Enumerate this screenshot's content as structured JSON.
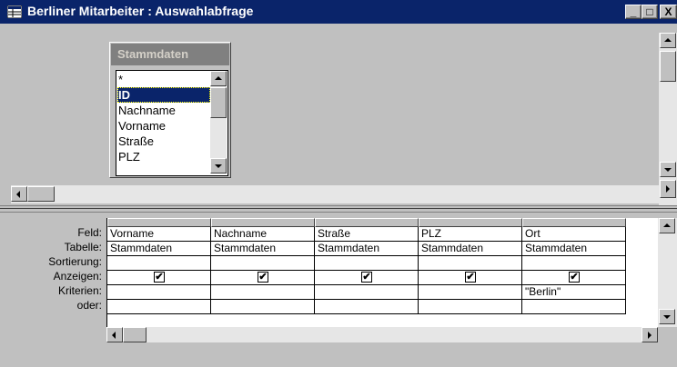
{
  "window": {
    "title": "Berliner Mitarbeiter : Auswahlabfrage",
    "buttons": {
      "minimize": "_",
      "maximize": "□",
      "close": "X"
    }
  },
  "field_list": {
    "title": "Stammdaten",
    "items": [
      "*",
      "ID",
      "Nachname",
      "Vorname",
      "Straße",
      "PLZ"
    ],
    "selected_index": 1
  },
  "grid": {
    "row_labels": [
      "Feld:",
      "Tabelle:",
      "Sortierung:",
      "Anzeigen:",
      "Kriterien:",
      "oder:"
    ],
    "columns": [
      {
        "feld": "Vorname",
        "tabelle": "Stammdaten",
        "sortierung": "",
        "anzeigen": true,
        "kriterien": "",
        "oder": ""
      },
      {
        "feld": "Nachname",
        "tabelle": "Stammdaten",
        "sortierung": "",
        "anzeigen": true,
        "kriterien": "",
        "oder": ""
      },
      {
        "feld": "Straße",
        "tabelle": "Stammdaten",
        "sortierung": "",
        "anzeigen": true,
        "kriterien": "",
        "oder": ""
      },
      {
        "feld": "PLZ",
        "tabelle": "Stammdaten",
        "sortierung": "",
        "anzeigen": true,
        "kriterien": "",
        "oder": ""
      },
      {
        "feld": "Ort",
        "tabelle": "Stammdaten",
        "sortierung": "",
        "anzeigen": true,
        "kriterien": "\"Berlin\"",
        "oder": ""
      }
    ],
    "checkbox_mark": "✔"
  },
  "colors": {
    "titlebar": "#0a246a",
    "face": "#c0c0c0",
    "selection": "#0a246a"
  }
}
